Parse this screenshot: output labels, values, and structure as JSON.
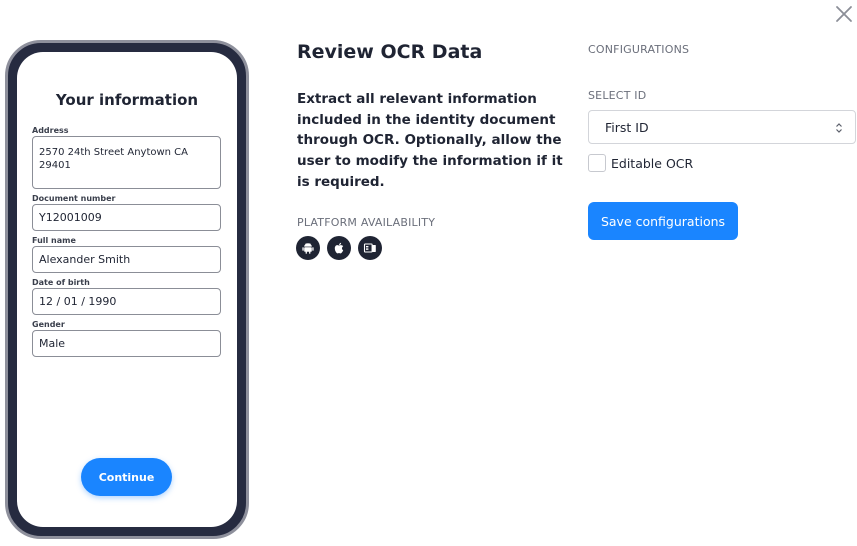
{
  "phone": {
    "title": "Your information",
    "fields": [
      {
        "label": "Address",
        "value": "2570 24th Street Anytown CA 29401"
      },
      {
        "label": "Document number",
        "value": "Y12001009"
      },
      {
        "label": "Full name",
        "value": "Alexander Smith"
      },
      {
        "label": "Date of birth",
        "value": "12 / 01 / 1990"
      },
      {
        "label": "Gender",
        "value": "Male"
      }
    ],
    "continue_label": "Continue"
  },
  "main": {
    "title": "Review OCR Data",
    "description": "Extract all relevant information included in the identity document through OCR. Optionally, allow the user to modify the information if it is required.",
    "platform_label": "PLATFORM AVAILABILITY",
    "platforms": [
      "android-icon",
      "apple-icon",
      "web-icon"
    ]
  },
  "config": {
    "heading": "CONFIGURATIONS",
    "select_label": "SELECT ID",
    "select_value": "First ID",
    "checkbox_label": "Editable OCR",
    "checkbox_checked": false,
    "save_label": "Save configurations"
  },
  "colors": {
    "accent": "#1a85ff",
    "phone_frame": "#262b40",
    "text": "#1f2433",
    "muted": "#6b6f7b"
  }
}
